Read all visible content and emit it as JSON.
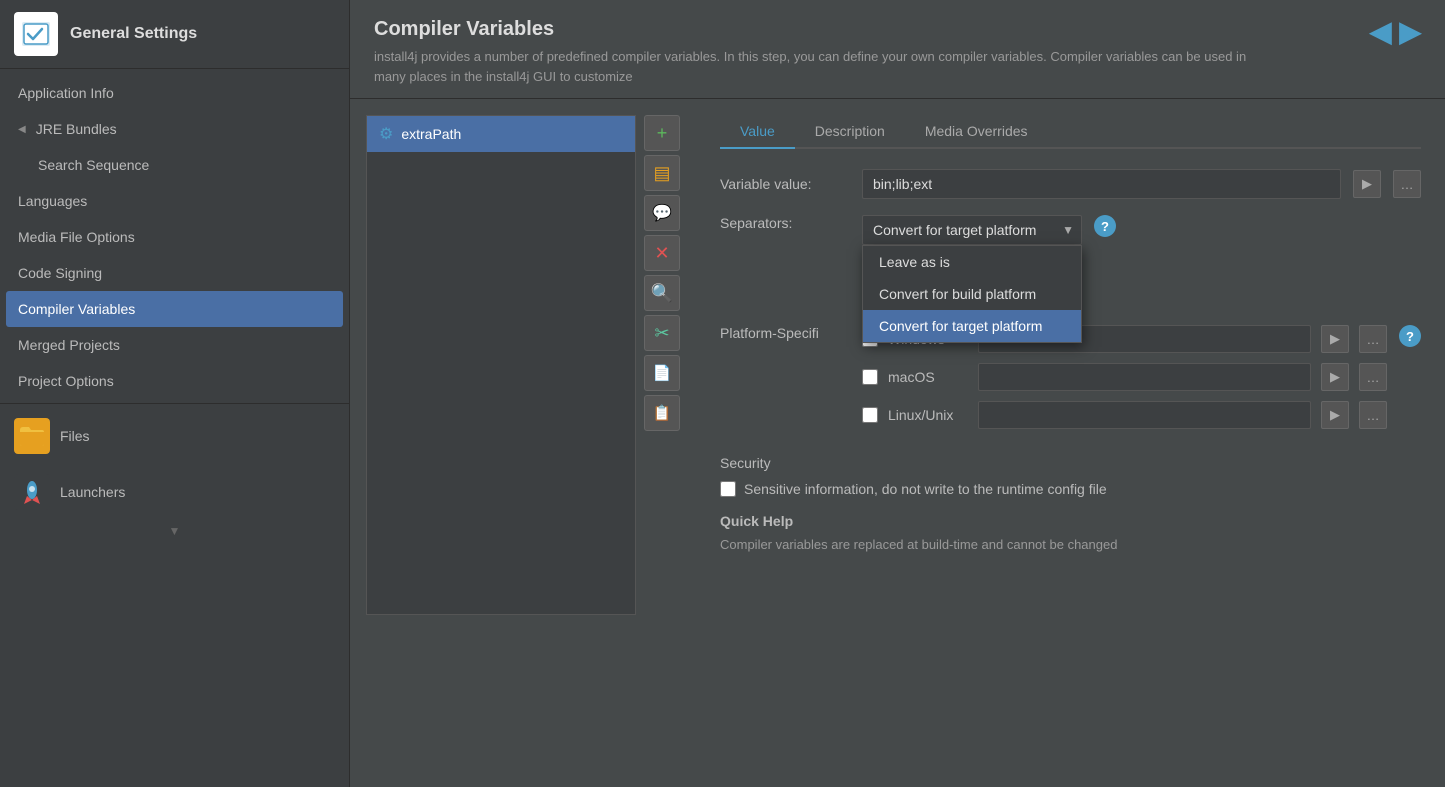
{
  "sidebar": {
    "header": {
      "title": "General Settings"
    },
    "items": [
      {
        "id": "application-info",
        "label": "Application Info",
        "indented": false,
        "active": false
      },
      {
        "id": "jre-bundles",
        "label": "JRE Bundles",
        "indented": false,
        "active": false,
        "hasChevron": true
      },
      {
        "id": "search-sequence",
        "label": "Search Sequence",
        "indented": true,
        "active": false
      },
      {
        "id": "languages",
        "label": "Languages",
        "indented": false,
        "active": false
      },
      {
        "id": "media-file-options",
        "label": "Media File Options",
        "indented": false,
        "active": false
      },
      {
        "id": "code-signing",
        "label": "Code Signing",
        "indented": false,
        "active": false
      },
      {
        "id": "compiler-variables",
        "label": "Compiler Variables",
        "indented": false,
        "active": true
      },
      {
        "id": "merged-projects",
        "label": "Merged Projects",
        "indented": false,
        "active": false
      },
      {
        "id": "project-options",
        "label": "Project Options",
        "indented": false,
        "active": false
      }
    ],
    "sections": [
      {
        "id": "files",
        "label": "Files",
        "iconColor": "#e6a020"
      },
      {
        "id": "launchers",
        "label": "Launchers",
        "iconColor": "#4a9cc7"
      }
    ]
  },
  "main": {
    "title": "Compiler Variables",
    "description": "install4j provides a number of predefined compiler variables. In this step, you can define your own compiler variables. Compiler variables can be used in many places in the install4j GUI to customize",
    "nav": {
      "back_label": "◀",
      "forward_label": "▶"
    }
  },
  "list": {
    "items": [
      {
        "id": "extraPath",
        "label": "extraPath",
        "selected": true
      }
    ]
  },
  "action_buttons": [
    {
      "id": "add",
      "icon": "+",
      "class": "green"
    },
    {
      "id": "folder",
      "icon": "▤",
      "class": "orange"
    },
    {
      "id": "comment",
      "icon": "💬",
      "class": "yellow"
    },
    {
      "id": "delete",
      "icon": "✕",
      "class": "red"
    },
    {
      "id": "search",
      "icon": "🔍",
      "class": "blue"
    },
    {
      "id": "cut",
      "icon": "✂",
      "class": "teal"
    },
    {
      "id": "new",
      "icon": "📄",
      "class": "gray"
    },
    {
      "id": "copy",
      "icon": "📋",
      "class": "gray"
    }
  ],
  "tabs": [
    {
      "id": "value",
      "label": "Value",
      "active": true
    },
    {
      "id": "description",
      "label": "Description",
      "active": false
    },
    {
      "id": "media-overrides",
      "label": "Media Overrides",
      "active": false
    }
  ],
  "form": {
    "variable_value_label": "Variable value:",
    "variable_value": "bin;lib;ext",
    "separators_label": "Separators:",
    "separators_selected": "Convert for target platform",
    "separators_options": [
      {
        "id": "leave-as-is",
        "label": "Leave as is",
        "selected": false
      },
      {
        "id": "convert-for-build",
        "label": "Convert for build platform",
        "selected": false
      },
      {
        "id": "convert-for-target",
        "label": "Convert for target platform",
        "selected": true
      }
    ],
    "platform_specific_label": "Platform-Specifi",
    "platforms": [
      {
        "id": "windows",
        "label": "Windows",
        "checked": false,
        "value": ""
      },
      {
        "id": "macos",
        "label": "macOS",
        "checked": false,
        "value": ""
      },
      {
        "id": "linux",
        "label": "Linux/Unix",
        "checked": false,
        "value": ""
      }
    ],
    "security_label": "Security",
    "sensitive_checkbox_label": "Sensitive information, do not write to the runtime config file",
    "quick_help_title": "Quick Help",
    "quick_help_text": "Compiler variables are replaced at build-time and cannot be changed"
  },
  "icons": {
    "chevron_left": "◀",
    "chevron_right": "▶",
    "gear": "⚙",
    "folder": "📁",
    "rocket": "🚀",
    "question": "?",
    "play": "▶",
    "ellipsis": "…",
    "down_arrow": "▼"
  }
}
